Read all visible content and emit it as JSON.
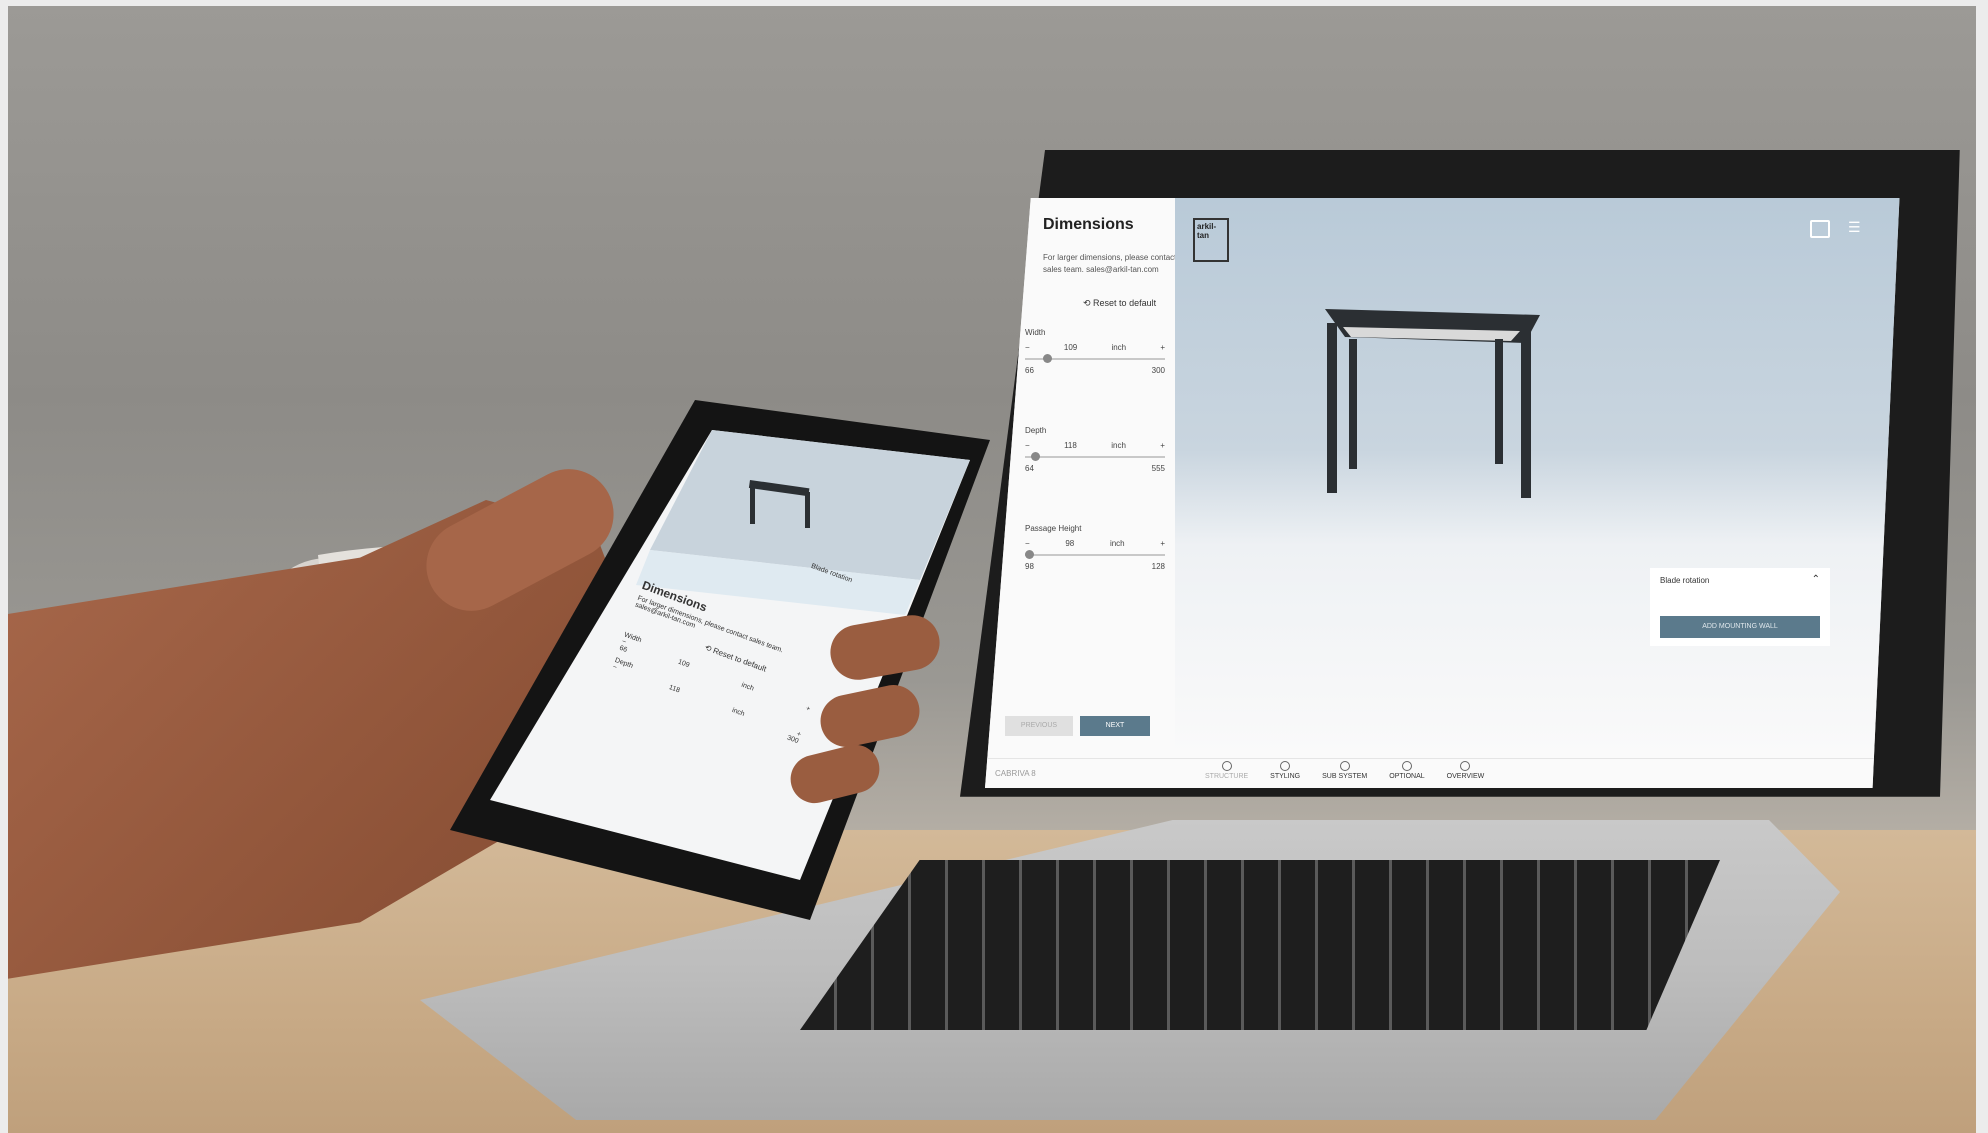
{
  "laptop": {
    "sidebar": {
      "title": "Dimensions",
      "subtitle": "For larger dimensions, please contact sales team. sales@arkil-tan.com",
      "reset_label": "Reset to default",
      "width": {
        "label": "Width",
        "value": "109",
        "unit": "inch",
        "min": "66",
        "max": "300"
      },
      "depth": {
        "label": "Depth",
        "value": "118",
        "unit": "inch",
        "min": "64",
        "max": "555"
      },
      "passage_height": {
        "label": "Passage Height",
        "value": "98",
        "unit": "inch",
        "min": "98",
        "max": "128"
      },
      "previous_label": "PREVIOUS",
      "next_label": "NEXT"
    },
    "logo_text": "arkil-tan",
    "blade_rotation_label": "Blade rotation",
    "add_wall_label": "ADD MOUNTING WALL",
    "bottom": {
      "name": "CABRIVA 8",
      "steps": [
        {
          "label": "STRUCTURE",
          "active": false
        },
        {
          "label": "STYLING",
          "active": true
        },
        {
          "label": "SUB SYSTEM",
          "active": true
        },
        {
          "label": "OPTIONAL",
          "active": true
        },
        {
          "label": "OVERVIEW",
          "active": true
        }
      ]
    }
  },
  "phone": {
    "blade_rotation_label": "Blade rotation",
    "title": "Dimensions",
    "subtitle": "For larger dimensions, please contact sales team. sales@arkil-tan.com",
    "reset_label": "Reset to default",
    "width": {
      "label": "Width",
      "value": "109",
      "unit": "inch",
      "min": "66"
    },
    "depth": {
      "label": "Depth",
      "value": "118",
      "unit": "inch",
      "max": "300"
    }
  },
  "colors": {
    "accent": "#5b7a8c",
    "scene_sky": "#b9cad8",
    "wall": "#f2f2f2"
  }
}
